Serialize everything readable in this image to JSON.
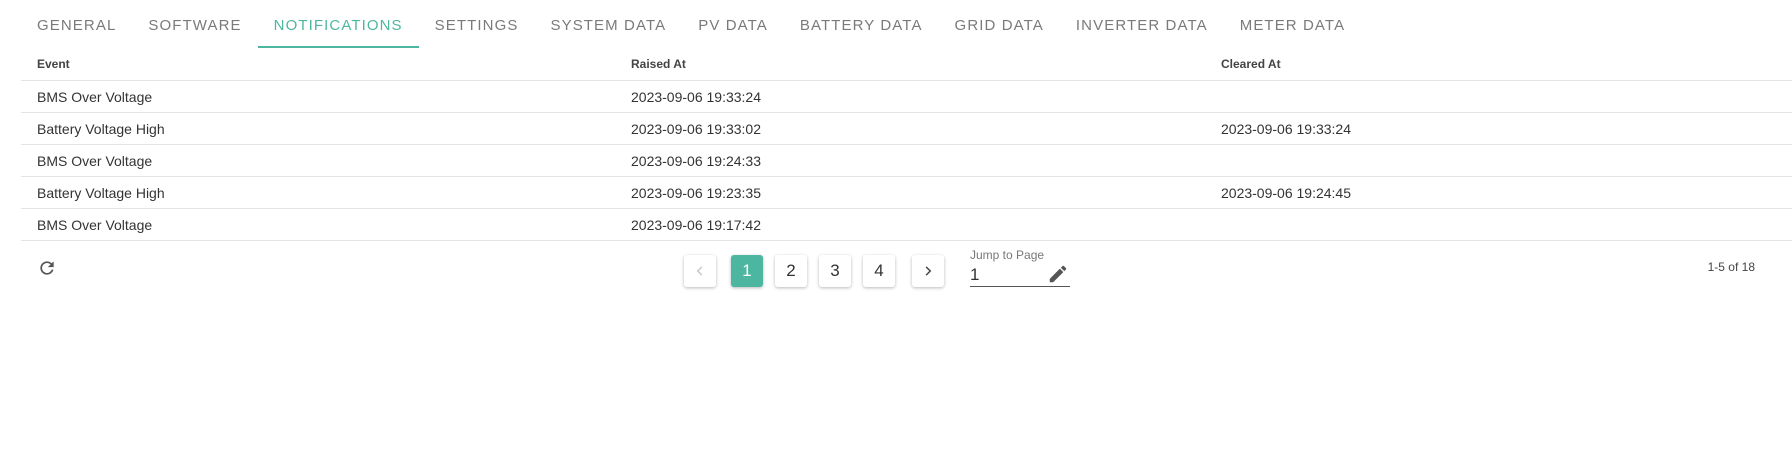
{
  "tabs": [
    {
      "label": "GENERAL",
      "active": false
    },
    {
      "label": "SOFTWARE",
      "active": false
    },
    {
      "label": "NOTIFICATIONS",
      "active": true
    },
    {
      "label": "SETTINGS",
      "active": false
    },
    {
      "label": "SYSTEM DATA",
      "active": false
    },
    {
      "label": "PV DATA",
      "active": false
    },
    {
      "label": "BATTERY DATA",
      "active": false
    },
    {
      "label": "GRID DATA",
      "active": false
    },
    {
      "label": "INVERTER DATA",
      "active": false
    },
    {
      "label": "METER DATA",
      "active": false
    }
  ],
  "table": {
    "columns": [
      "Event",
      "Raised At",
      "Cleared At"
    ],
    "rows": [
      [
        "BMS Over Voltage",
        "2023-09-06 19:33:24",
        ""
      ],
      [
        "Battery Voltage High",
        "2023-09-06 19:33:02",
        "2023-09-06 19:33:24"
      ],
      [
        "BMS Over Voltage",
        "2023-09-06 19:24:33",
        ""
      ],
      [
        "Battery Voltage High",
        "2023-09-06 19:23:35",
        "2023-09-06 19:24:45"
      ],
      [
        "BMS Over Voltage",
        "2023-09-06 19:17:42",
        ""
      ]
    ]
  },
  "pagination": {
    "prev_icon": "chevron-left-icon",
    "next_icon": "chevron-right-icon",
    "pages": [
      "1",
      "2",
      "3",
      "4"
    ],
    "current_page": "1",
    "jump_label": "Jump to Page",
    "jump_value": "1",
    "jump_icon": "pencil-icon",
    "range_text": "1-5 of 18"
  },
  "refresh_icon": "refresh-icon",
  "colors": {
    "accent": "#4db6a0",
    "tab_inactive": "#7a7a7a",
    "divider": "#e3e3e3"
  }
}
